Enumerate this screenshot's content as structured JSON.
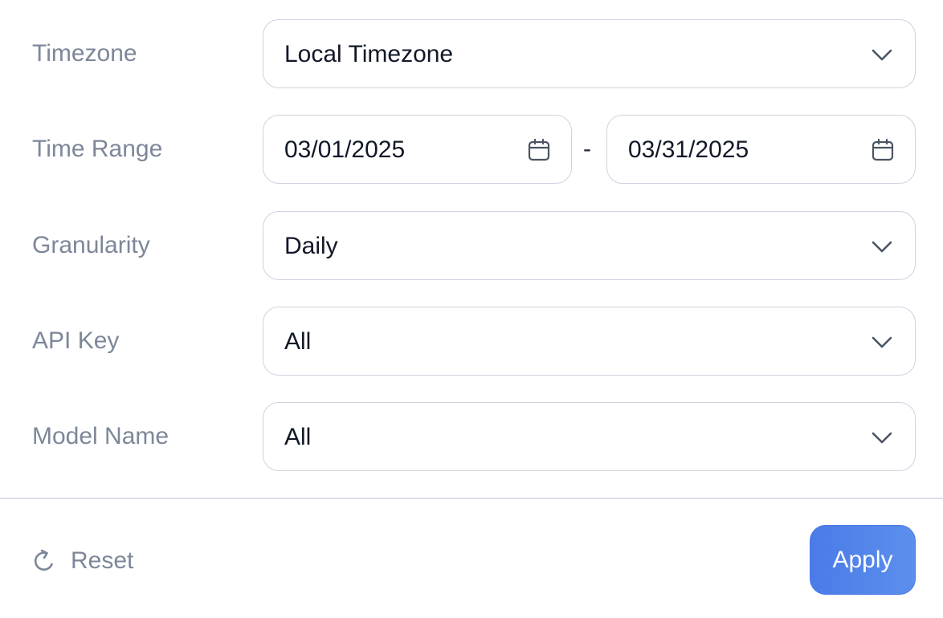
{
  "filters": {
    "timezone": {
      "label": "Timezone",
      "selected": "Local Timezone",
      "icon": "chevron-down-icon"
    },
    "time_range": {
      "label": "Time Range",
      "start_date": "03/01/2025",
      "separator": "-",
      "end_date": "03/31/2025",
      "icon": "calendar-icon"
    },
    "granularity": {
      "label": "Granularity",
      "selected": "Daily",
      "icon": "chevron-down-icon"
    },
    "api_key": {
      "label": "API Key",
      "selected": "All",
      "icon": "chevron-down-icon"
    },
    "model_name": {
      "label": "Model Name",
      "selected": "All",
      "icon": "chevron-down-icon"
    }
  },
  "footer": {
    "reset_label": "Reset",
    "reset_icon": "refresh-icon",
    "apply_label": "Apply"
  },
  "colors": {
    "label_text": "#7d8799",
    "value_text": "#111827",
    "field_border": "#ced3de",
    "accent": "#4a7be8",
    "divider": "#dcdfe6"
  }
}
